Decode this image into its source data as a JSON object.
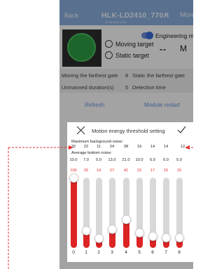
{
  "header": {
    "back_label": "Back",
    "title": "HLK-LD2410_770A",
    "version_label": "10.05.0042.1704",
    "small_label": "Ast",
    "more_label": "More"
  },
  "status": {
    "engineering_mode_label": "Engineering mode",
    "moving_target_label": "Moving target",
    "static_target_label": "Static target",
    "distance_value": "--",
    "distance_unit": "M"
  },
  "info": {
    "moving_farthest_label": "Moving the farthest gate",
    "moving_farthest_value": "8",
    "static_farthest_label": "Static the farthest gate",
    "unmanned_label": "Unmanned duration(s)",
    "unmanned_value": "5",
    "detection_time_label": "Detection time"
  },
  "actions": {
    "refresh_label": "Refresh",
    "restart_label": "Module restart"
  },
  "dialog": {
    "title": "Motion energy threshold setting",
    "max_noise_label": "Maximum background noise:",
    "max_noise_values": [
      "32",
      "22",
      "11",
      "24",
      "38",
      "19",
      "14",
      "14",
      "12"
    ],
    "avg_noise_label": "Average bottom noise:",
    "avg_noise_values": [
      "10.0",
      "7.0",
      "5.0",
      "13.0",
      "21.0",
      "10.0",
      "6.0",
      "6.0",
      "5.0"
    ],
    "threshold_values": [
      "100",
      "25",
      "14",
      "27",
      "41",
      "22",
      "17",
      "15",
      "15"
    ],
    "gates": [
      "0",
      "1",
      "2",
      "3",
      "4",
      "5",
      "6",
      "7",
      "8"
    ],
    "slider_levels": [
      100,
      25,
      14,
      27,
      41,
      22,
      17,
      15,
      15
    ],
    "threshold_color": "#e8292a",
    "bar_fill_color": "#dc2424"
  },
  "colors": {
    "header_bg": "#8bb1e0",
    "accent": "#6f95dd",
    "annotation": "#e03030"
  }
}
